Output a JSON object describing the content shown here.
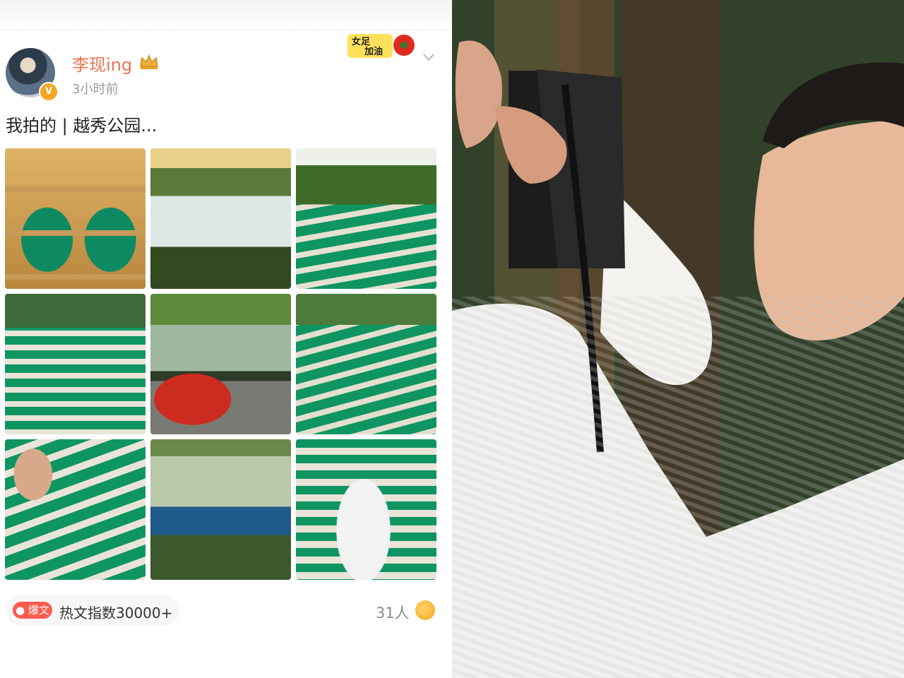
{
  "post": {
    "username": "李现ing",
    "time": "3小时前",
    "text": "我拍的 | 越秀公园...",
    "sticker_text_1": "女足",
    "sticker_text_2": "加油",
    "verified": "V",
    "badge_label": "爆文",
    "badge_text": "热文指数30000+",
    "likes": "31人"
  },
  "icons": {
    "avatar": "avatar",
    "crown": "crown-icon",
    "chevron": "chevron-down-icon",
    "fire": "fire-icon",
    "emoji": "laugh-emoji-icon"
  },
  "colors": {
    "username": "#eb7350",
    "badge": "#ff5a4e",
    "seat_green": "#0f9562"
  }
}
